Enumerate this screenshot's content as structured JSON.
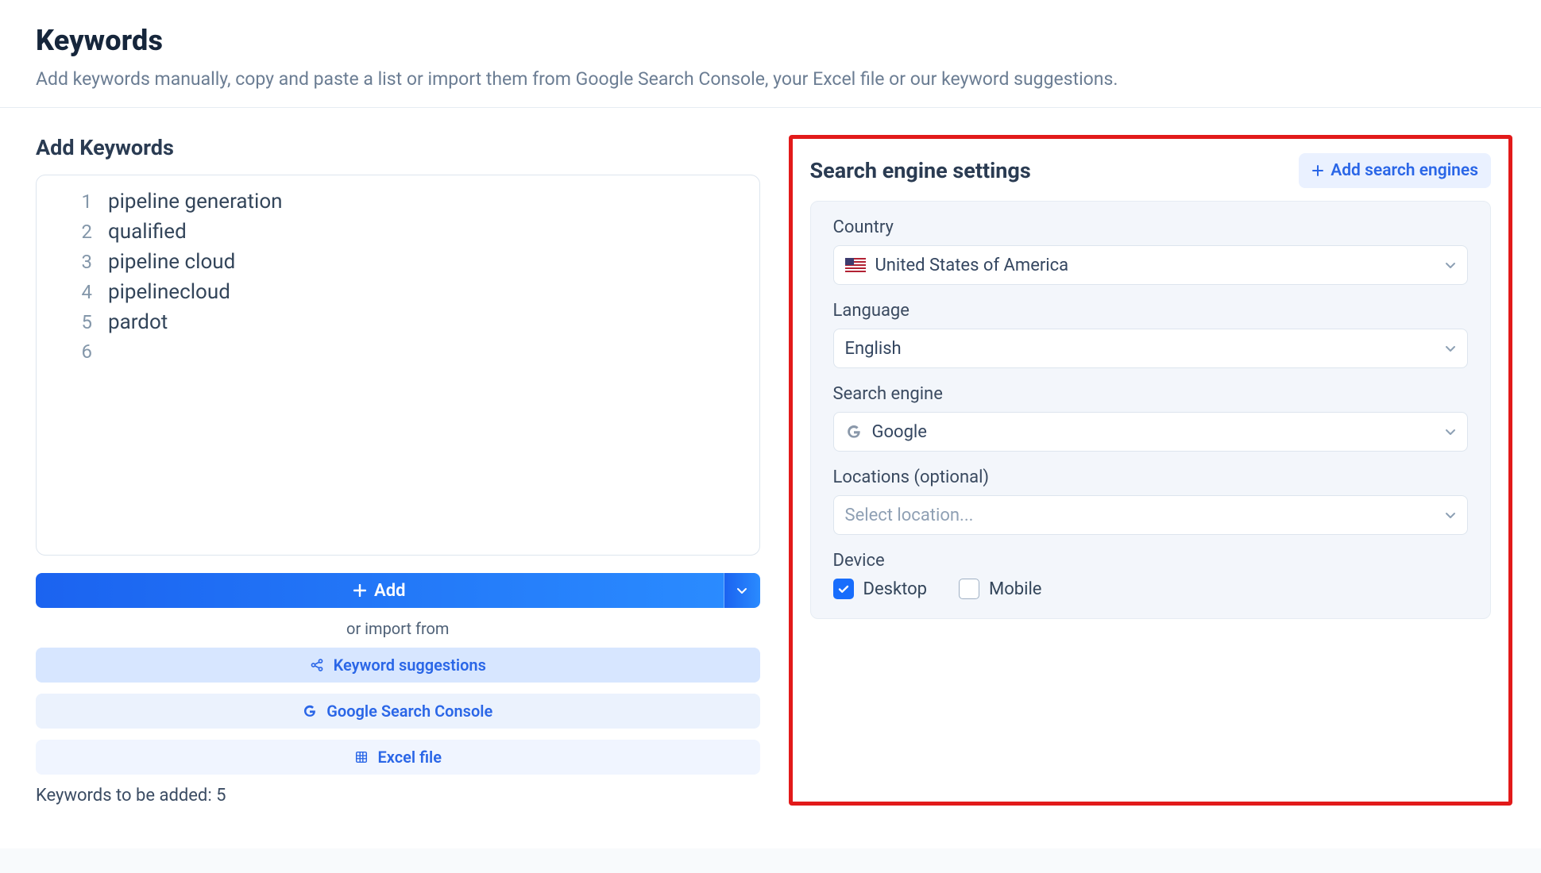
{
  "header": {
    "title": "Keywords",
    "subtitle": "Add keywords manually, copy and paste a list or import them from Google Search Console, your Excel file or our keyword suggestions."
  },
  "left": {
    "title": "Add Keywords",
    "rows": [
      {
        "num": "1",
        "text": "pipeline generation"
      },
      {
        "num": "2",
        "text": "qualified"
      },
      {
        "num": "3",
        "text": "pipeline cloud"
      },
      {
        "num": "4",
        "text": "pipelinecloud"
      },
      {
        "num": "5",
        "text": "pardot"
      },
      {
        "num": "6",
        "text": ""
      }
    ],
    "add_label": "Add",
    "import_label": "or import from",
    "buttons": {
      "kw_suggestions": "Keyword suggestions",
      "gsc": "Google Search Console",
      "excel": "Excel file"
    },
    "count_text": "Keywords to be added: 5"
  },
  "right": {
    "title": "Search engine settings",
    "add_engines": "Add search engines",
    "fields": {
      "country": {
        "label": "Country",
        "value": "United States of America"
      },
      "language": {
        "label": "Language",
        "value": "English"
      },
      "engine": {
        "label": "Search engine",
        "value": "Google"
      },
      "locations": {
        "label": "Locations (optional)",
        "placeholder": "Select location..."
      },
      "device": {
        "label": "Device",
        "desktop": "Desktop",
        "mobile": "Mobile",
        "desktop_checked": true,
        "mobile_checked": false
      }
    }
  }
}
